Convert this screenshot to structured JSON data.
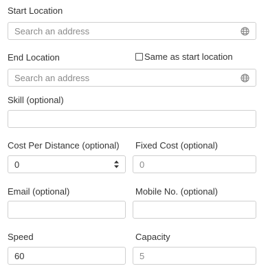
{
  "start_location": {
    "label": "Start Location",
    "placeholder": "Search an address",
    "icon": "globe-icon"
  },
  "end_location": {
    "label": "End Location",
    "placeholder": "Search an address",
    "icon": "globe-icon",
    "same_as_start_label": "Same as start location",
    "same_as_start_checked": false
  },
  "skill": {
    "label": "Skill (optional)",
    "value": ""
  },
  "cost_per_distance": {
    "label": "Cost Per Distance (optional)",
    "value": "0"
  },
  "fixed_cost": {
    "label": "Fixed Cost (optional)",
    "value": "0"
  },
  "email": {
    "label": "Email (optional)",
    "value": ""
  },
  "mobile": {
    "label": "Mobile No. (optional)",
    "value": ""
  },
  "speed": {
    "label": "Speed",
    "value": "60"
  },
  "capacity": {
    "label": "Capacity",
    "value": "5"
  }
}
